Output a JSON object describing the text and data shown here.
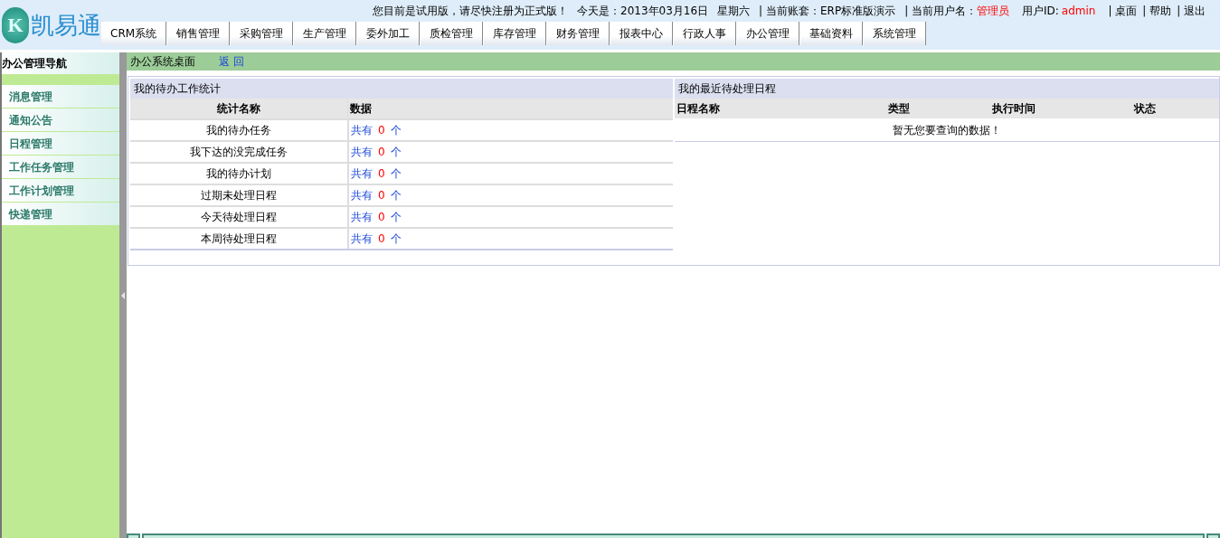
{
  "logo": {
    "letter": "K",
    "name": "凯易通"
  },
  "top_bar": {
    "notice": "您目前是试用版，请尽快注册为正式版！",
    "date": "今天是：2013年03月16日",
    "weekday": "星期六",
    "account": "| 当前账套：ERP标准版演示",
    "user_label": "| 当前用户名：",
    "user_name": "管理员",
    "user_id_label": "用户ID:",
    "user_id": "admin",
    "links": [
      "| 桌面",
      "| 帮助",
      "| 退出"
    ]
  },
  "menu": [
    "CRM系统",
    "销售管理",
    "采购管理",
    "生产管理",
    "委外加工",
    "质检管理",
    "库存管理",
    "财务管理",
    "报表中心",
    "行政人事",
    "办公管理",
    "基础资料",
    "系统管理"
  ],
  "sidebar": {
    "title": "办公管理导航",
    "items": [
      "消息管理",
      "通知公告",
      "日程管理",
      "工作任务管理",
      "工作计划管理",
      "快递管理"
    ]
  },
  "breadcrumb": {
    "title": "办公系统桌面",
    "back": "返 回"
  },
  "stats": {
    "title": "我的待办工作统计",
    "columns": [
      "统计名称",
      "数据"
    ],
    "rows": [
      {
        "name": "我的待办任务",
        "prefix": "共有",
        "count": "0",
        "unit": "个"
      },
      {
        "name": "我下达的没完成任务",
        "prefix": "共有",
        "count": "0",
        "unit": "个"
      },
      {
        "name": "我的待办计划",
        "prefix": "共有",
        "count": "0",
        "unit": "个"
      },
      {
        "name": "过期未处理日程",
        "prefix": "共有",
        "count": "0",
        "unit": "个"
      },
      {
        "name": "今天待处理日程",
        "prefix": "共有",
        "count": "0",
        "unit": "个"
      },
      {
        "name": "本周待处理日程",
        "prefix": "共有",
        "count": "0",
        "unit": "个"
      }
    ]
  },
  "schedule": {
    "title": "我的最近待处理日程",
    "columns": [
      "日程名称",
      "类型",
      "执行时间",
      "状态"
    ],
    "empty": "暂无您要查询的数据！"
  }
}
